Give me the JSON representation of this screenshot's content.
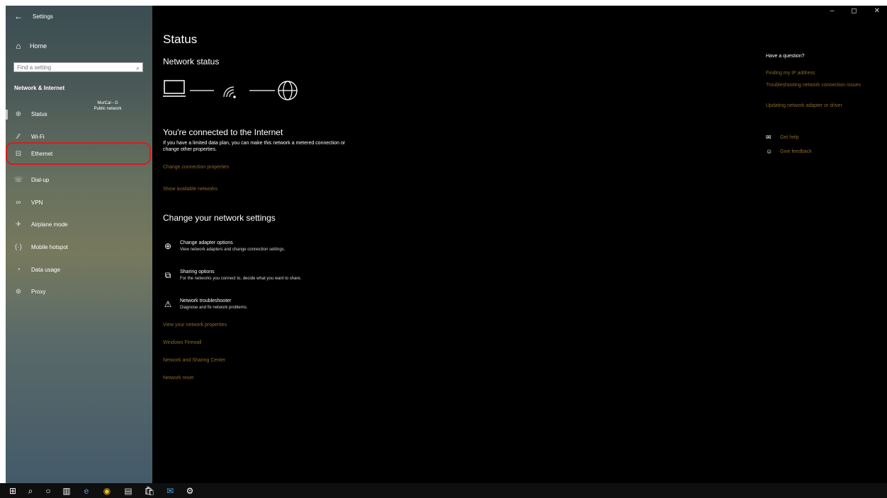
{
  "window": {
    "title": "Settings"
  },
  "sidebar": {
    "home_label": "Home",
    "search": {
      "placeholder": "Find a setting"
    },
    "section_title": "Network & Internet",
    "items": [
      {
        "label": "Status",
        "icon": "status-globe-icon"
      },
      {
        "label": "Wi-Fi",
        "icon": "wifi-icon"
      },
      {
        "label": "Ethernet",
        "icon": "ethernet-icon"
      },
      {
        "label": "Dial-up",
        "icon": "dialup-icon"
      },
      {
        "label": "VPN",
        "icon": "vpn-icon"
      },
      {
        "label": "Airplane mode",
        "icon": "airplane-icon"
      },
      {
        "label": "Mobile hotspot",
        "icon": "hotspot-icon"
      },
      {
        "label": "Data usage",
        "icon": "data-usage-icon"
      },
      {
        "label": "Proxy",
        "icon": "proxy-globe-icon"
      }
    ]
  },
  "main": {
    "title": "Status",
    "network_status_heading": "Network status",
    "network_name": "MurCal - G",
    "network_type": "Public network",
    "connected_heading": "You're connected to the Internet",
    "connected_desc": "If you have a limited data plan, you can make this network a metered connection or change other properties.",
    "change_connection_link": "Change connection properties",
    "show_networks_link": "Show available networks",
    "change_settings_heading": "Change your network settings",
    "settings": [
      {
        "title": "Change adapter options",
        "desc": "View network adapters and change connection settings.",
        "icon": "adapter-icon"
      },
      {
        "title": "Sharing options",
        "desc": "For the networks you connect to, decide what you want to share.",
        "icon": "sharing-icon"
      },
      {
        "title": "Network troubleshooter",
        "desc": "Diagnose and fix network problems.",
        "icon": "warning-icon"
      }
    ],
    "links": [
      "View your network properties",
      "Windows Firewall",
      "Network and Sharing Center",
      "Network reset"
    ]
  },
  "right_panel": {
    "question_heading": "Have a question?",
    "links": [
      "Finding my IP address",
      "Troubleshooting network connection issues",
      "Updating network adapter or driver"
    ],
    "get_help": "Get help",
    "give_feedback": "Give feedback"
  },
  "window_controls": {
    "minimize": "–",
    "maximize": "◻",
    "close": "✕"
  },
  "colors": {
    "link": "#8b6b25",
    "highlight_outline": "#d11f1f"
  }
}
